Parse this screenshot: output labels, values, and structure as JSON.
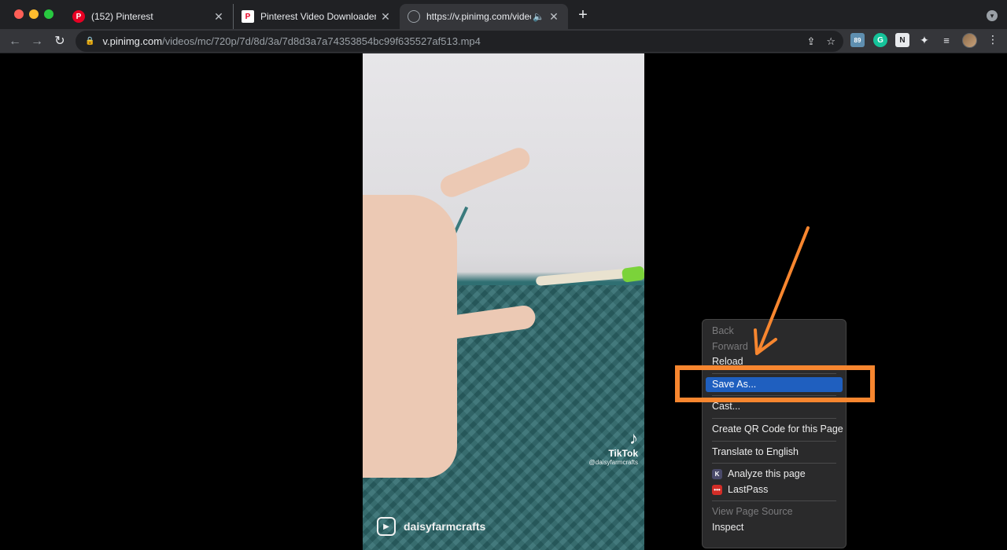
{
  "tabs": [
    {
      "title": "(152) Pinterest",
      "icon": "pinterest-icon"
    },
    {
      "title": "Pinterest Video Downloader - D",
      "icon": "downloader-icon"
    },
    {
      "title": "https://v.pinimg.com/videos",
      "icon": "globe-icon",
      "audio": "🔈"
    }
  ],
  "new_tab_glyph": "+",
  "toolbar": {
    "url_host": "v.pinimg.com",
    "url_path": "/videos/mc/720p/7d/8d/3a/7d8d3a7a74353854bc99f635527af513.mp4",
    "lock_glyph": "🔒",
    "share_glyph": "⇪",
    "star_glyph": "☆",
    "ext_cal": "89",
    "ext_g": "G",
    "ext_n": "N",
    "ext_puzzle": "✦",
    "ext_list": "≡",
    "kebab": "⋮"
  },
  "video": {
    "watermark_brand": "TikTok",
    "watermark_handle": "@daisyfarmcrafts",
    "reel_name": "daisyfarmcrafts"
  },
  "context_menu": {
    "items": [
      {
        "label": "Back",
        "disabled": true
      },
      {
        "label": "Forward",
        "disabled": true
      },
      {
        "label": "Reload",
        "disabled": false
      },
      {
        "label": "Save As...",
        "selected": true
      },
      {
        "label": "Cast..."
      },
      {
        "label": "Create QR Code for this Page"
      },
      {
        "label": "Translate to English"
      },
      {
        "label": "Analyze this page",
        "icon": "k-extension-icon"
      },
      {
        "label": "LastPass",
        "icon": "lastpass-icon"
      },
      {
        "label": "View Page Source",
        "disabled": true
      },
      {
        "label": "Inspect"
      }
    ]
  },
  "annotation": {
    "color": "#f7862f"
  }
}
